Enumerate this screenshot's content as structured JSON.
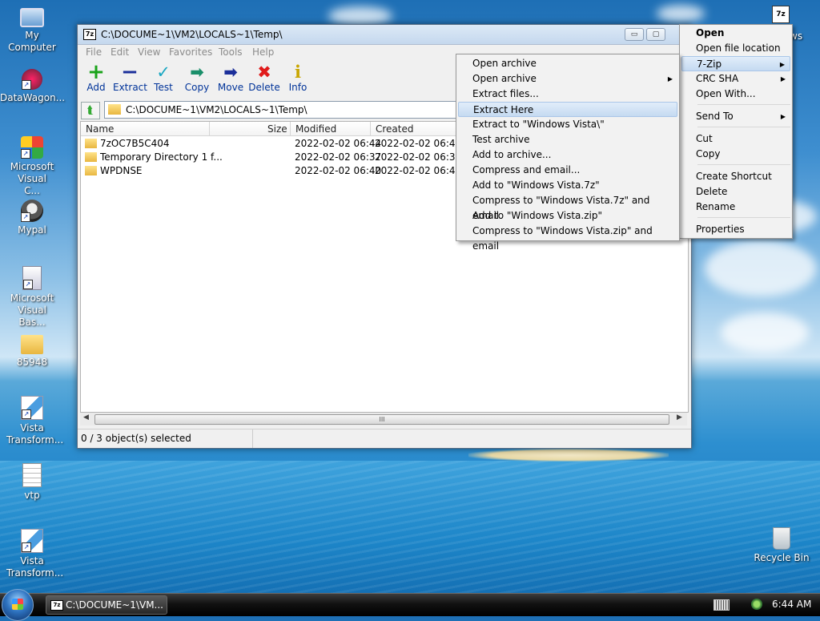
{
  "desktop": {
    "icons": [
      {
        "label": "My Computer"
      },
      {
        "label": "DataWagon..."
      },
      {
        "label": "Microsoft Visual C..."
      },
      {
        "label": "Mypal"
      },
      {
        "label": "Microsoft Visual Bas..."
      },
      {
        "label": "85948"
      },
      {
        "label": "Vista Transform..."
      },
      {
        "label": "vtp"
      },
      {
        "label": "Vista Transform..."
      },
      {
        "label": "Recycle Bin"
      }
    ],
    "topright_icon_text": "7z",
    "partial_text": "ws"
  },
  "window": {
    "app_icon_text": "7z",
    "title": "C:\\DOCUME~1\\VM2\\LOCALS~1\\Temp\\",
    "minimize_glyph": "▭",
    "maximize_glyph": "▢",
    "menus": [
      "File",
      "Edit",
      "View",
      "Favorites",
      "Tools",
      "Help"
    ],
    "toolbar": [
      {
        "label": "Add",
        "icon": "plus-icon",
        "glyph": "+",
        "color": "#1aa31a"
      },
      {
        "label": "Extract",
        "icon": "minus-icon",
        "glyph": "−",
        "color": "#1b2f9a"
      },
      {
        "label": "Test",
        "icon": "check-icon",
        "glyph": "✓",
        "color": "#1aa7c2"
      },
      {
        "label": "Copy",
        "icon": "copy-arrow-icon",
        "glyph": "➡",
        "color": "#1a8f6a"
      },
      {
        "label": "Move",
        "icon": "move-arrow-icon",
        "glyph": "➡",
        "color": "#1b2f9a"
      },
      {
        "label": "Delete",
        "icon": "delete-x-icon",
        "glyph": "✖",
        "color": "#e01b1b"
      },
      {
        "label": "Info",
        "icon": "info-icon",
        "glyph": "i",
        "color": "#c9a600"
      }
    ],
    "address": "C:\\DOCUME~1\\VM2\\LOCALS~1\\Temp\\",
    "up_glyph": "⮬",
    "columns": {
      "name": "Name",
      "size": "Size",
      "modified": "Modified",
      "created": "Created"
    },
    "rows": [
      {
        "name": "7zOC7B5C404",
        "modified": "2022-02-02 06:44",
        "created": "2022-02-02 06:44"
      },
      {
        "name": "Temporary Directory 1 f...",
        "modified": "2022-02-02 06:37",
        "created": "2022-02-02 06:37"
      },
      {
        "name": "WPDNSE",
        "modified": "2022-02-02 06:40",
        "created": "2022-02-02 06:40"
      }
    ],
    "scroll_grip": "III",
    "status": "0 / 3 object(s) selected"
  },
  "context_menu": {
    "items": [
      "Open",
      "Open file location",
      "7-Zip",
      "CRC SHA",
      "Open With...",
      "Send To",
      "Cut",
      "Copy",
      "Create Shortcut",
      "Delete",
      "Rename",
      "Properties"
    ]
  },
  "zip_submenu": {
    "items": [
      "Open archive",
      "Open archive",
      "Extract files...",
      "Extract Here",
      "Extract to \"Windows Vista\\\"",
      "Test archive",
      "Add to archive...",
      "Compress and email...",
      "Add to \"Windows Vista.7z\"",
      "Compress to \"Windows Vista.7z\" and email",
      "Add to \"Windows Vista.zip\"",
      "Compress to \"Windows Vista.zip\" and email"
    ],
    "highlighted": "Extract Here"
  },
  "taskbar": {
    "task_icon_text": "7z",
    "task_label": "C:\\DOCUME~1\\VM...",
    "clock": "6:44 AM"
  }
}
